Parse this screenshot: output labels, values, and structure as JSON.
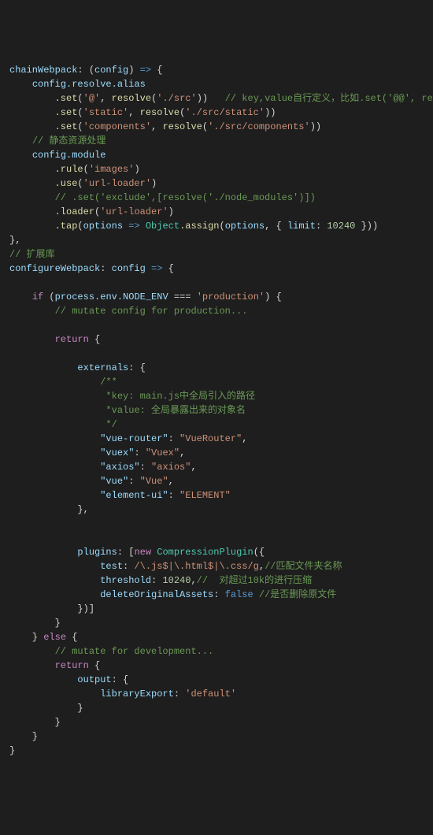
{
  "code": {
    "l1_chainWebpack": "chainWebpack",
    "l1_config": "config",
    "l2_resolve_alias": "config.resolve.alias",
    "l3_set": ".set",
    "l3_at": "'@'",
    "l3_resolve": "resolve",
    "l3_src": "'./src'",
    "l3_cmt": "// key,value自行定义，比如.set('@@', resolve('src/components'))",
    "l4_static": "'static'",
    "l4_static_path": "'./src/static'",
    "l5_components": "'components'",
    "l5_components_path": "'./src/components'",
    "l6_cmt": "// 静态资源处理",
    "l7_module": "config.module",
    "l8_rule": ".rule",
    "l8_images": "'images'",
    "l9_use": ".use",
    "l9_url_loader": "'url-loader'",
    "l10_cmt": "// .set('exclude',[resolve('./node_modules')])",
    "l11_loader": ".loader",
    "l11_url_loader2": "'url-loader'",
    "l12_tap": ".tap",
    "l12_options": "options",
    "l12_object": "Object",
    "l12_assign": ".assign",
    "l12_limit": "limit",
    "l12_limit_val": "10240",
    "l14_cmt": "// 扩展库",
    "l15_configureWebpack": "configureWebpack",
    "l15_config2": "config",
    "l17_if": "if",
    "l17_process": "process",
    "l17_env": ".env.NODE_ENV",
    "l17_eq": "===",
    "l17_prod": "'production'",
    "l18_cmt": "// mutate config for production...",
    "l20_return": "return",
    "l22_externals": "externals",
    "l23_cmt1": "/**",
    "l24_cmt2": "*key: main.js中全局引入的路径",
    "l25_cmt3": "*value: 全局暴露出来的对象名",
    "l26_cmt4": "*/",
    "l27_k": "\"vue-router\"",
    "l27_v": "\"VueRouter\"",
    "l28_k": "\"vuex\"",
    "l28_v": "\"Vuex\"",
    "l29_k": "\"axios\"",
    "l29_v": "\"axios\"",
    "l30_k": "\"vue\"",
    "l30_v": "\"Vue\"",
    "l31_k": "\"element-ui\"",
    "l31_v": "\"ELEMENT\"",
    "l34_plugins": "plugins",
    "l34_new": "new",
    "l34_compression": "CompressionPlugin",
    "l35_test": "test",
    "l35_regex": "/\\.js$|\\.html$|\\.css/g",
    "l35_cmt": "//匹配文件夹名称",
    "l36_threshold": "threshold",
    "l36_val": "10240",
    "l36_cmt": "//  对超过10k的进行压缩",
    "l37_delete": "deleteOriginalAssets",
    "l37_false": "false",
    "l37_cmt": "//是否删除原文件",
    "l40_else": "else",
    "l41_cmt": "// mutate for development...",
    "l42_return2": "return",
    "l43_output": "output",
    "l44_library": "libraryExport",
    "l44_default": "'default'"
  }
}
